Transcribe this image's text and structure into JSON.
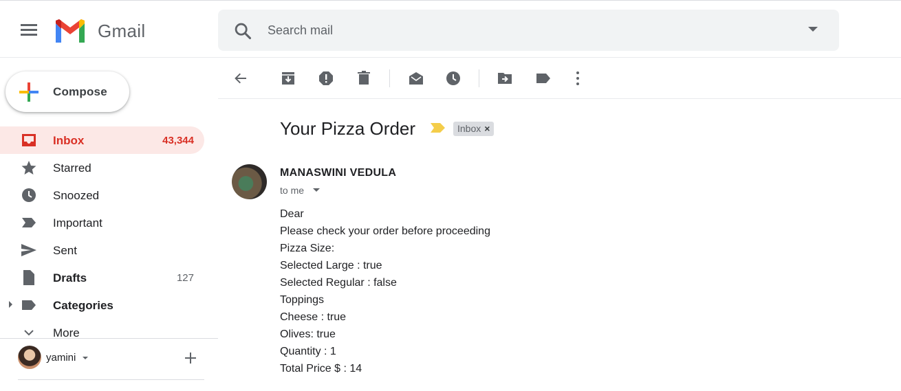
{
  "app": {
    "name": "Gmail"
  },
  "search": {
    "placeholder": "Search mail"
  },
  "compose": {
    "label": "Compose"
  },
  "sidebar": {
    "items": [
      {
        "label": "Inbox",
        "count": "43,344",
        "icon": "inbox-icon",
        "active": true
      },
      {
        "label": "Starred",
        "count": "",
        "icon": "star-icon"
      },
      {
        "label": "Snoozed",
        "count": "",
        "icon": "clock-icon"
      },
      {
        "label": "Important",
        "count": "",
        "icon": "important-icon"
      },
      {
        "label": "Sent",
        "count": "",
        "icon": "send-icon"
      },
      {
        "label": "Drafts",
        "count": "127",
        "icon": "draft-icon"
      },
      {
        "label": "Categories",
        "count": "",
        "icon": "label-icon"
      },
      {
        "label": "More",
        "count": "",
        "icon": "chevron-down-icon"
      }
    ]
  },
  "hangouts": {
    "user": "yamini"
  },
  "toolbar": {
    "buttons": [
      "back-icon",
      "archive-icon",
      "report-spam-icon",
      "delete-icon",
      "mark-unread-icon",
      "snooze-icon",
      "move-to-icon",
      "labels-icon",
      "more-vert-icon"
    ]
  },
  "message": {
    "subject": "Your Pizza Order",
    "label": "Inbox",
    "sender": "MANASWINI VEDULA",
    "to": "to me",
    "body": [
      "Dear",
      "Please check your order before proceeding",
      "Pizza Size:",
      "Selected Large : true",
      "Selected Regular : false",
      "Toppings",
      "Cheese : true",
      "Olives: true",
      "Quantity : 1",
      "Total Price $ : 14"
    ]
  },
  "colors": {
    "accent": "#d93025",
    "active_bg": "#fce8e6",
    "icon_gray": "#5f6368",
    "important_yellow": "#f4cd4a"
  }
}
